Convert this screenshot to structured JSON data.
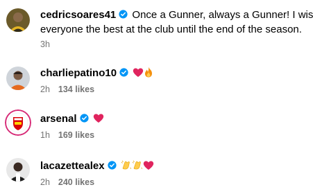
{
  "comments": [
    {
      "username": "cedricsoares41",
      "text_line1": "Once a Gunner, always a Gunner! I wish",
      "text_line2": "everyone the best at the club until the end of the season.",
      "time": "3h",
      "likes": ""
    },
    {
      "username": "charliepatino10",
      "emojis": [
        "red-heart",
        "fire"
      ],
      "time": "2h",
      "likes": "134 likes"
    },
    {
      "username": "arsenal",
      "emojis": [
        "red-heart"
      ],
      "time": "1h",
      "likes": "169 likes"
    },
    {
      "username": "lacazettealex",
      "emojis": [
        "clapping-hands",
        "clapping-hands",
        "red-heart"
      ],
      "time": "2h",
      "likes": "240 likes"
    }
  ],
  "colors": {
    "verified_blue": "#0095f6",
    "meta_gray": "#737373",
    "heart_red": "#e0245e",
    "arsenal_red": "#db0007"
  }
}
